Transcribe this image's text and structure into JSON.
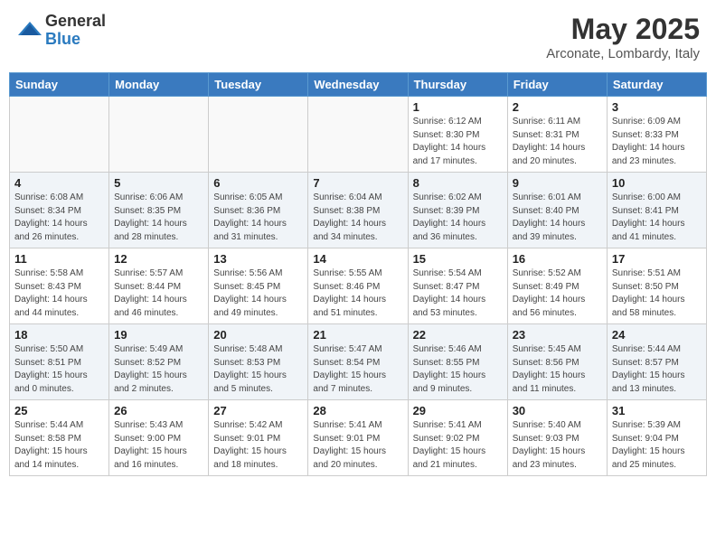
{
  "logo": {
    "general": "General",
    "blue": "Blue"
  },
  "header": {
    "month": "May 2025",
    "location": "Arconate, Lombardy, Italy"
  },
  "days_of_week": [
    "Sunday",
    "Monday",
    "Tuesday",
    "Wednesday",
    "Thursday",
    "Friday",
    "Saturday"
  ],
  "weeks": [
    [
      {
        "day": "",
        "info": ""
      },
      {
        "day": "",
        "info": ""
      },
      {
        "day": "",
        "info": ""
      },
      {
        "day": "",
        "info": ""
      },
      {
        "day": "1",
        "info": "Sunrise: 6:12 AM\nSunset: 8:30 PM\nDaylight: 14 hours\nand 17 minutes."
      },
      {
        "day": "2",
        "info": "Sunrise: 6:11 AM\nSunset: 8:31 PM\nDaylight: 14 hours\nand 20 minutes."
      },
      {
        "day": "3",
        "info": "Sunrise: 6:09 AM\nSunset: 8:33 PM\nDaylight: 14 hours\nand 23 minutes."
      }
    ],
    [
      {
        "day": "4",
        "info": "Sunrise: 6:08 AM\nSunset: 8:34 PM\nDaylight: 14 hours\nand 26 minutes."
      },
      {
        "day": "5",
        "info": "Sunrise: 6:06 AM\nSunset: 8:35 PM\nDaylight: 14 hours\nand 28 minutes."
      },
      {
        "day": "6",
        "info": "Sunrise: 6:05 AM\nSunset: 8:36 PM\nDaylight: 14 hours\nand 31 minutes."
      },
      {
        "day": "7",
        "info": "Sunrise: 6:04 AM\nSunset: 8:38 PM\nDaylight: 14 hours\nand 34 minutes."
      },
      {
        "day": "8",
        "info": "Sunrise: 6:02 AM\nSunset: 8:39 PM\nDaylight: 14 hours\nand 36 minutes."
      },
      {
        "day": "9",
        "info": "Sunrise: 6:01 AM\nSunset: 8:40 PM\nDaylight: 14 hours\nand 39 minutes."
      },
      {
        "day": "10",
        "info": "Sunrise: 6:00 AM\nSunset: 8:41 PM\nDaylight: 14 hours\nand 41 minutes."
      }
    ],
    [
      {
        "day": "11",
        "info": "Sunrise: 5:58 AM\nSunset: 8:43 PM\nDaylight: 14 hours\nand 44 minutes."
      },
      {
        "day": "12",
        "info": "Sunrise: 5:57 AM\nSunset: 8:44 PM\nDaylight: 14 hours\nand 46 minutes."
      },
      {
        "day": "13",
        "info": "Sunrise: 5:56 AM\nSunset: 8:45 PM\nDaylight: 14 hours\nand 49 minutes."
      },
      {
        "day": "14",
        "info": "Sunrise: 5:55 AM\nSunset: 8:46 PM\nDaylight: 14 hours\nand 51 minutes."
      },
      {
        "day": "15",
        "info": "Sunrise: 5:54 AM\nSunset: 8:47 PM\nDaylight: 14 hours\nand 53 minutes."
      },
      {
        "day": "16",
        "info": "Sunrise: 5:52 AM\nSunset: 8:49 PM\nDaylight: 14 hours\nand 56 minutes."
      },
      {
        "day": "17",
        "info": "Sunrise: 5:51 AM\nSunset: 8:50 PM\nDaylight: 14 hours\nand 58 minutes."
      }
    ],
    [
      {
        "day": "18",
        "info": "Sunrise: 5:50 AM\nSunset: 8:51 PM\nDaylight: 15 hours\nand 0 minutes."
      },
      {
        "day": "19",
        "info": "Sunrise: 5:49 AM\nSunset: 8:52 PM\nDaylight: 15 hours\nand 2 minutes."
      },
      {
        "day": "20",
        "info": "Sunrise: 5:48 AM\nSunset: 8:53 PM\nDaylight: 15 hours\nand 5 minutes."
      },
      {
        "day": "21",
        "info": "Sunrise: 5:47 AM\nSunset: 8:54 PM\nDaylight: 15 hours\nand 7 minutes."
      },
      {
        "day": "22",
        "info": "Sunrise: 5:46 AM\nSunset: 8:55 PM\nDaylight: 15 hours\nand 9 minutes."
      },
      {
        "day": "23",
        "info": "Sunrise: 5:45 AM\nSunset: 8:56 PM\nDaylight: 15 hours\nand 11 minutes."
      },
      {
        "day": "24",
        "info": "Sunrise: 5:44 AM\nSunset: 8:57 PM\nDaylight: 15 hours\nand 13 minutes."
      }
    ],
    [
      {
        "day": "25",
        "info": "Sunrise: 5:44 AM\nSunset: 8:58 PM\nDaylight: 15 hours\nand 14 minutes."
      },
      {
        "day": "26",
        "info": "Sunrise: 5:43 AM\nSunset: 9:00 PM\nDaylight: 15 hours\nand 16 minutes."
      },
      {
        "day": "27",
        "info": "Sunrise: 5:42 AM\nSunset: 9:01 PM\nDaylight: 15 hours\nand 18 minutes."
      },
      {
        "day": "28",
        "info": "Sunrise: 5:41 AM\nSunset: 9:01 PM\nDaylight: 15 hours\nand 20 minutes."
      },
      {
        "day": "29",
        "info": "Sunrise: 5:41 AM\nSunset: 9:02 PM\nDaylight: 15 hours\nand 21 minutes."
      },
      {
        "day": "30",
        "info": "Sunrise: 5:40 AM\nSunset: 9:03 PM\nDaylight: 15 hours\nand 23 minutes."
      },
      {
        "day": "31",
        "info": "Sunrise: 5:39 AM\nSunset: 9:04 PM\nDaylight: 15 hours\nand 25 minutes."
      }
    ]
  ]
}
